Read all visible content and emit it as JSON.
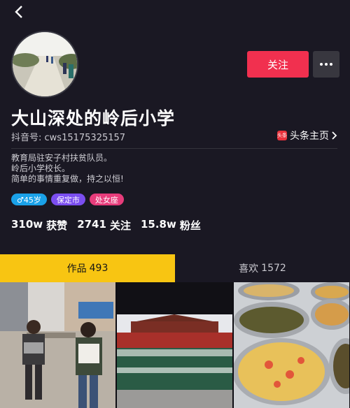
{
  "profile": {
    "name": "大山深处的岭后小学",
    "account_id": "抖音号: cws15175325157",
    "toutiao_label": "头条主页",
    "toutiao_logo_text": "头条",
    "follow_label": "关注",
    "bio_lines": [
      "教育局驻安子村扶贫队员。",
      "岭后小学校长。",
      "简单的事情重复做，持之以恒!"
    ],
    "tags": [
      {
        "icon": "male-icon",
        "label": "♂45岁",
        "color": "#1aa1e8"
      },
      {
        "label": "保定市",
        "color": "#7b4ef0"
      },
      {
        "label": "处女座",
        "color": "#e73c7b"
      }
    ],
    "stats": [
      {
        "value": "310w",
        "label": "获赞"
      },
      {
        "value": "2741",
        "label": "关注"
      },
      {
        "value": "15.8w",
        "label": "粉丝"
      }
    ]
  },
  "tabs": [
    {
      "label": "作品",
      "count": "493",
      "active": true
    },
    {
      "label": "喜欢",
      "count": "1572",
      "active": false
    }
  ],
  "colors": {
    "background": "#1a1823",
    "follow_button": "#f1304f",
    "active_tab": "#f8c512"
  },
  "icons": {
    "back": "chevron-left-icon",
    "more": "more-dots-icon",
    "link": "chevron-right-icon"
  }
}
